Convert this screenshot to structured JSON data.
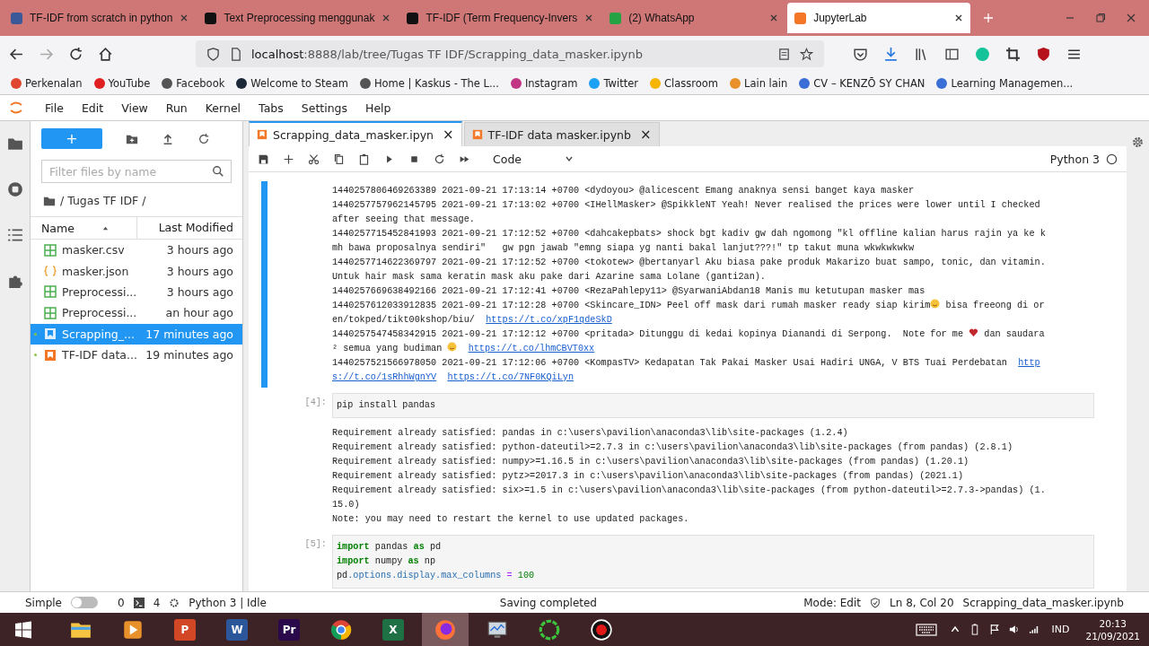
{
  "browser": {
    "tabs": [
      {
        "title": "TF-IDF from scratch in python",
        "color": "#3b5998",
        "selected": false
      },
      {
        "title": "Text Preprocessing menggunak",
        "color": "#111111",
        "selected": false
      },
      {
        "title": "TF-IDF (Term Frequency-Invers",
        "color": "#111111",
        "selected": false
      },
      {
        "title": "(2) WhatsApp",
        "color": "#25a244",
        "selected": false
      },
      {
        "title": "JupyterLab",
        "color": "#f37726",
        "selected": true
      }
    ],
    "url_host": "localhost",
    "url_rest": ":8888/lab/tree/Tugas TF IDF/Scrapping_data_masker.ipynb",
    "bookmarks": [
      {
        "label": "Perkenalan",
        "color": "#e0462f"
      },
      {
        "label": "YouTube",
        "color": "#e02020"
      },
      {
        "label": "Facebook",
        "color": "#555555"
      },
      {
        "label": "Welcome to Steam",
        "color": "#1b2838"
      },
      {
        "label": "Home | Kaskus - The L...",
        "color": "#555555"
      },
      {
        "label": "Instagram",
        "color": "#c13584"
      },
      {
        "label": "Twitter",
        "color": "#1da1f2"
      },
      {
        "label": "Classroom",
        "color": "#f4b400"
      },
      {
        "label": "Lain lain",
        "color": "#e8902a"
      },
      {
        "label": "CV – KENZŌ SY CHAN",
        "color": "#3a6fd8"
      },
      {
        "label": "Learning Managemen...",
        "color": "#3a6fd8"
      }
    ]
  },
  "menu": [
    "File",
    "Edit",
    "View",
    "Run",
    "Kernel",
    "Tabs",
    "Settings",
    "Help"
  ],
  "file_browser": {
    "new_label": "+",
    "filter_placeholder": "Filter files by name",
    "path": "/ Tugas TF IDF /",
    "columns": [
      "Name",
      "Last Modified"
    ],
    "files": [
      {
        "name": "masker.csv",
        "modified": "3 hours ago",
        "kind": "table",
        "selected": false,
        "running": false
      },
      {
        "name": "masker.json",
        "modified": "3 hours ago",
        "kind": "json",
        "selected": false,
        "running": false
      },
      {
        "name": "Preprocessi...",
        "modified": "3 hours ago",
        "kind": "table",
        "selected": false,
        "running": false
      },
      {
        "name": "Preprocessi...",
        "modified": "an hour ago",
        "kind": "table",
        "selected": false,
        "running": false
      },
      {
        "name": "Scrapping_...",
        "modified": "17 minutes ago",
        "kind": "notebook",
        "selected": true,
        "running": true
      },
      {
        "name": "TF-IDF data...",
        "modified": "19 minutes ago",
        "kind": "notebook",
        "selected": false,
        "running": true
      }
    ]
  },
  "notebook_tabs": [
    {
      "title": "Scrapping_data_masker.ipyn",
      "selected": true,
      "close": "×"
    },
    {
      "title": "TF-IDF data masker.ipynb",
      "selected": false,
      "close": "×"
    }
  ],
  "toolbar": {
    "cell_type": "Code",
    "kernel": "Python 3"
  },
  "cells": [
    {
      "kind": "output",
      "selected": true,
      "lines": [
        [
          {
            "kind": "text",
            "text": "1440257806469263389 2021-09-21 17:13:14 +0700 <dydoyou> @alicescent Emang anaknya sensi banget kaya masker"
          }
        ],
        [
          {
            "kind": "text",
            "text": "1440257757962145795 2021-09-21 17:13:02 +0700 <IHellMasker> @SpikkleNT Yeah! Never realised the prices were lower until I checked"
          }
        ],
        [
          {
            "kind": "text",
            "text": "after seeing that message."
          }
        ],
        [
          {
            "kind": "text",
            "text": "1440257715452841993 2021-09-21 17:12:52 +0700 <dahcakepbats> shock bgt kadiv gw dah ngomong \"kl offline kalian harus rajin ya ke k"
          }
        ],
        [
          {
            "kind": "text",
            "text": "mh bawa proposalnya sendiri\"   gw pgn jawab \"emng siapa yg nanti bakal lanjut???!\" tp takut muna wkwkwkwkw"
          }
        ],
        [
          {
            "kind": "text",
            "text": "1440257714622369797 2021-09-21 17:12:52 +0700 <tokotew> @bertanyarl Aku biasa pake produk Makarizo buat sampo, tonic, dan vitamin."
          }
        ],
        [
          {
            "kind": "text",
            "text": "Untuk hair mask sama keratin mask aku pake dari Azarine sama Lolane (ganti2an)."
          }
        ],
        [
          {
            "kind": "text",
            "text": "1440257669638492166 2021-09-21 17:12:41 +0700 <RezaPahlepy11> @SyarwaniAbdan18 Manis mu ketutupan masker mas"
          }
        ],
        [
          {
            "kind": "text",
            "text": "1440257612033912835 2021-09-21 17:12:28 +0700 <Skincare_IDN> Peel off mask dari rumah masker ready siap kirim"
          },
          {
            "kind": "smiley"
          },
          {
            "kind": "text",
            "text": " bisa freeong di or"
          }
        ],
        [
          {
            "kind": "text",
            "text": "en/tokped/tikt00kshop/biu/  "
          },
          {
            "kind": "link",
            "text": "https://t.co/xpF1qdeSkD"
          }
        ],
        [
          {
            "kind": "text",
            "text": "1440257547458342915 2021-09-21 17:12:12 +0700 <pritada> Ditunggu di kedai kopinya Dianandi di Serpong.  Note for me "
          },
          {
            "kind": "heart"
          },
          {
            "kind": "text",
            "text": " dan saudara"
          }
        ],
        [
          {
            "kind": "text",
            "text": "² semua yang budiman "
          },
          {
            "kind": "smiley"
          },
          {
            "kind": "link",
            "text": "https://t.co/lhmCBVT0xx"
          }
        ],
        [
          {
            "kind": "text",
            "text": "1440257521566978050 2021-09-21 17:12:06 +0700 <KompasTV> Kedapatan Tak Pakai Masker Usai Hadiri UNGA, V BTS Tuai Perdebatan  "
          },
          {
            "kind": "link",
            "text": "http"
          }
        ],
        [
          {
            "kind": "link",
            "text": "s://t.co/1sRhhWgnYV"
          },
          {
            "kind": "link",
            "text": "https://t.co/7NF0KQiLyn"
          }
        ]
      ]
    },
    {
      "kind": "code",
      "prompt": "[4]:",
      "selected": false,
      "lines": [
        [
          {
            "kind": "text",
            "text": "pip install pandas"
          }
        ]
      ]
    },
    {
      "kind": "output",
      "selected": false,
      "lines": [
        [
          {
            "kind": "text",
            "text": "Requirement already satisfied: pandas in c:\\users\\pavilion\\anaconda3\\lib\\site-packages (1.2.4)"
          }
        ],
        [
          {
            "kind": "text",
            "text": "Requirement already satisfied: python-dateutil>=2.7.3 in c:\\users\\pavilion\\anaconda3\\lib\\site-packages (from pandas) (2.8.1)"
          }
        ],
        [
          {
            "kind": "text",
            "text": "Requirement already satisfied: numpy>=1.16.5 in c:\\users\\pavilion\\anaconda3\\lib\\site-packages (from pandas) (1.20.1)"
          }
        ],
        [
          {
            "kind": "text",
            "text": "Requirement already satisfied: pytz>=2017.3 in c:\\users\\pavilion\\anaconda3\\lib\\site-packages (from pandas) (2021.1)"
          }
        ],
        [
          {
            "kind": "text",
            "text": "Requirement already satisfied: six>=1.5 in c:\\users\\pavilion\\anaconda3\\lib\\site-packages (from python-dateutil>=2.7.3->pandas) (1."
          }
        ],
        [
          {
            "kind": "text",
            "text": "15.0)"
          }
        ],
        [
          {
            "kind": "text",
            "text": "Note: you may need to restart the kernel to use updated packages."
          }
        ]
      ]
    },
    {
      "kind": "code",
      "prompt": "[5]:",
      "selected": false,
      "lines": [
        [
          {
            "kind": "keyword",
            "text": "import"
          },
          {
            "kind": "text",
            "text": " pandas "
          },
          {
            "kind": "keyword",
            "text": "as"
          },
          {
            "kind": "text",
            "text": " pd"
          }
        ],
        [
          {
            "kind": "keyword",
            "text": "import"
          },
          {
            "kind": "text",
            "text": " numpy "
          },
          {
            "kind": "keyword",
            "text": "as"
          },
          {
            "kind": "text",
            "text": " np"
          }
        ],
        [
          {
            "kind": "text",
            "text": "pd"
          },
          {
            "kind": "attr",
            "text": ".options.display.max_columns"
          },
          {
            "kind": "op",
            "text": " = "
          },
          {
            "kind": "number",
            "text": "100"
          }
        ]
      ]
    }
  ],
  "status_bar": {
    "mode_label": "Simple",
    "simple_on": false,
    "terminals": "0",
    "kernels": "4",
    "kernel_status": "Python 3 | Idle",
    "message": "Saving completed",
    "edit_mode": "Mode: Edit",
    "position": "Ln 8, Col 20",
    "file": "Scrapping_data_masker.ipynb"
  },
  "taskbar": {
    "apps": [
      {
        "kind": "explorer",
        "selected": false
      },
      {
        "kind": "player",
        "selected": false
      },
      {
        "kind": "office",
        "label": "P",
        "color": "#d24726",
        "selected": false
      },
      {
        "kind": "office",
        "label": "W",
        "color": "#2b579a",
        "selected": false
      },
      {
        "kind": "office",
        "label": "Pr",
        "color": "#2a0a4a",
        "selected": false
      },
      {
        "kind": "chrome",
        "selected": false
      },
      {
        "kind": "office",
        "label": "X",
        "color": "#1e7145",
        "selected": false
      },
      {
        "kind": "firefox",
        "selected": true
      },
      {
        "kind": "monitor",
        "selected": false
      },
      {
        "kind": "ring",
        "selected": false
      },
      {
        "kind": "record",
        "selected": false
      }
    ],
    "language": "IND",
    "time": "20:13",
    "date": "21/09/2021"
  }
}
